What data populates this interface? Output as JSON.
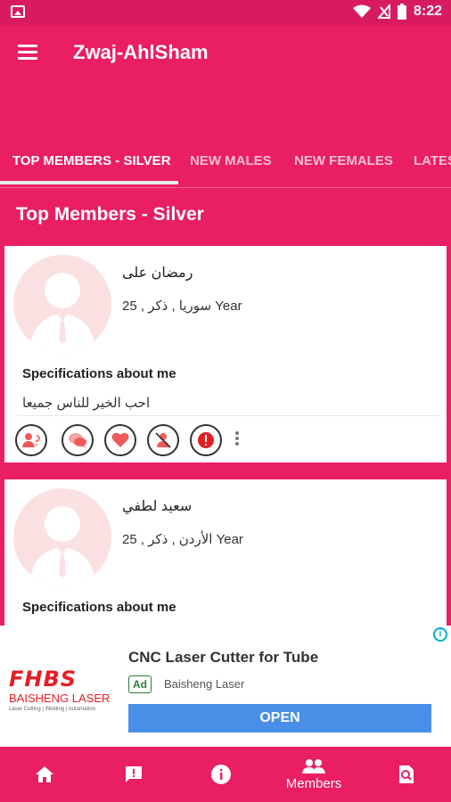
{
  "status_bar": {
    "time": "8:22"
  },
  "app_bar": {
    "title": "Zwaj-AhlSham"
  },
  "tabs": [
    {
      "label": "TOP MEMBERS - SILVER",
      "active": true
    },
    {
      "label": "NEW MALES",
      "active": false
    },
    {
      "label": "NEW FEMALES",
      "active": false
    },
    {
      "label": "LATES",
      "active": false
    }
  ],
  "section": {
    "title": "Top Members - Silver"
  },
  "members": [
    {
      "name": "رمضان على",
      "info": "25 , سوريا , ذكر Year",
      "spec_label": "Specifications about me",
      "spec_text": "احب الخير للناس جميعا"
    },
    {
      "name": "سعيد لطفي",
      "info": "25 , الأردن , ذكر Year",
      "spec_label": "Specifications about me"
    }
  ],
  "card_actions": [
    "add-user-icon",
    "chat-icon",
    "heart-icon",
    "block-user-icon",
    "report-icon",
    "more-vert-icon"
  ],
  "ad": {
    "brand": "FHBS",
    "company": "BAISHENG LASER",
    "tagline": "Laser Cutting | Welding | Automation",
    "title": "CNC Laser Cutter for Tube",
    "badge": "Ad",
    "advertiser": "Baisheng Laser",
    "cta": "OPEN"
  },
  "bottom_nav": [
    {
      "icon": "home-icon",
      "label": ""
    },
    {
      "icon": "feedback-icon",
      "label": ""
    },
    {
      "icon": "info-icon",
      "label": ""
    },
    {
      "icon": "members-icon",
      "label": "Members"
    },
    {
      "icon": "search-doc-icon",
      "label": ""
    }
  ],
  "colors": {
    "primary": "#e91e63",
    "primary_dark": "#d81b60",
    "ad_button": "#4a8fe7",
    "brand_red": "#e31e24"
  }
}
